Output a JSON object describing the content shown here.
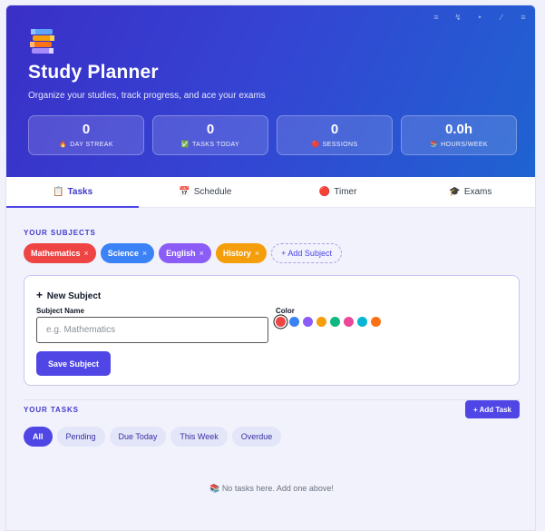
{
  "header": {
    "title": "Study Planner",
    "subtitle": "Organize your studies, track progress, and ace your exams",
    "logo_icon": "books-icon",
    "toolbar_icons": [
      "menu-icon",
      "stats-icon",
      "sync-icon",
      "pen-icon",
      "options-icon"
    ]
  },
  "stats": [
    {
      "value": "0",
      "label": "DAY STREAK",
      "icon": "🔥"
    },
    {
      "value": "0",
      "label": "TASKS TODAY",
      "icon": "✅"
    },
    {
      "value": "0",
      "label": "SESSIONS",
      "icon": "🔴"
    },
    {
      "value": "0.0h",
      "label": "HOURS/WEEK",
      "icon": "📚"
    }
  ],
  "tabs": [
    {
      "label": "Tasks",
      "icon": "📋",
      "active": true
    },
    {
      "label": "Schedule",
      "icon": "📅",
      "active": false
    },
    {
      "label": "Timer",
      "icon": "🔴",
      "active": false
    },
    {
      "label": "Exams",
      "icon": "🎓",
      "active": false
    }
  ],
  "subjects": {
    "section_label": "YOUR SUBJECTS",
    "items": [
      {
        "name": "Mathematics",
        "color": "#ef4444"
      },
      {
        "name": "Science",
        "color": "#3b82f6"
      },
      {
        "name": "English",
        "color": "#8b5cf6"
      },
      {
        "name": "History",
        "color": "#f59e0b"
      }
    ],
    "remove_glyph": "×",
    "add_label": "+ Add Subject"
  },
  "new_subject": {
    "title": "New Subject",
    "name_label": "Subject Name",
    "name_placeholder": "e.g. Mathematics",
    "name_value": "",
    "color_label": "Color",
    "colors": [
      "#ef4444",
      "#3b82f6",
      "#8b5cf6",
      "#f59e0b",
      "#10b981",
      "#ec4899",
      "#06b6d4",
      "#f97316"
    ],
    "selected_color": "#ef4444",
    "save_label": "Save Subject"
  },
  "tasks": {
    "section_label": "YOUR TASKS",
    "add_label": "+ Add Task",
    "filters": [
      {
        "label": "All",
        "active": true
      },
      {
        "label": "Pending",
        "active": false
      },
      {
        "label": "Due Today",
        "active": false
      },
      {
        "label": "This Week",
        "active": false
      },
      {
        "label": "Overdue",
        "active": false
      }
    ],
    "empty_icon": "📚",
    "empty_text": "No tasks here. Add one above!"
  }
}
